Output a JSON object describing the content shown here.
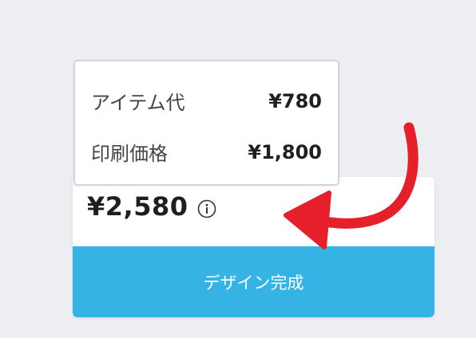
{
  "breakdown": {
    "items": [
      {
        "label": "アイテム代",
        "value": "¥780"
      },
      {
        "label": "印刷価格",
        "value": "¥1,800"
      }
    ]
  },
  "order": {
    "total_price": "¥2,580",
    "info_icon": "info-circle-icon",
    "finish_button_label": "デザイン完成"
  },
  "annotation": {
    "icon": "curved-arrow-icon",
    "color": "#e5202b"
  },
  "colors": {
    "background": "#eceef2",
    "button": "#34b3e4",
    "arrow": "#e5202b"
  }
}
